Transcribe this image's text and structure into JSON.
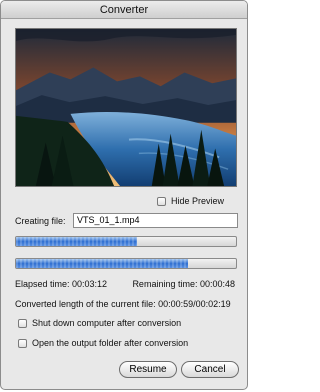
{
  "window": {
    "title": "Converter"
  },
  "preview": {
    "hide_preview_label": "Hide Preview",
    "hide_preview_checked": false
  },
  "file": {
    "label": "Creating file:",
    "value": "VTS_01_1.mp4"
  },
  "progress": {
    "file_fraction": 0.55,
    "total_fraction": 0.78
  },
  "times": {
    "elapsed": "Elapsed time: 00:03:12",
    "remaining": "Remaining time: 00:00:48",
    "converted": "Converted length of the current file: 00:00:59/00:02:19"
  },
  "options": {
    "shutdown_label": "Shut down computer after conversion",
    "shutdown_checked": false,
    "open_folder_label": "Open the output folder after conversion",
    "open_folder_checked": false
  },
  "buttons": {
    "resume": "Resume",
    "cancel": "Cancel"
  },
  "colors": {
    "progress": "#2f6fd1"
  }
}
